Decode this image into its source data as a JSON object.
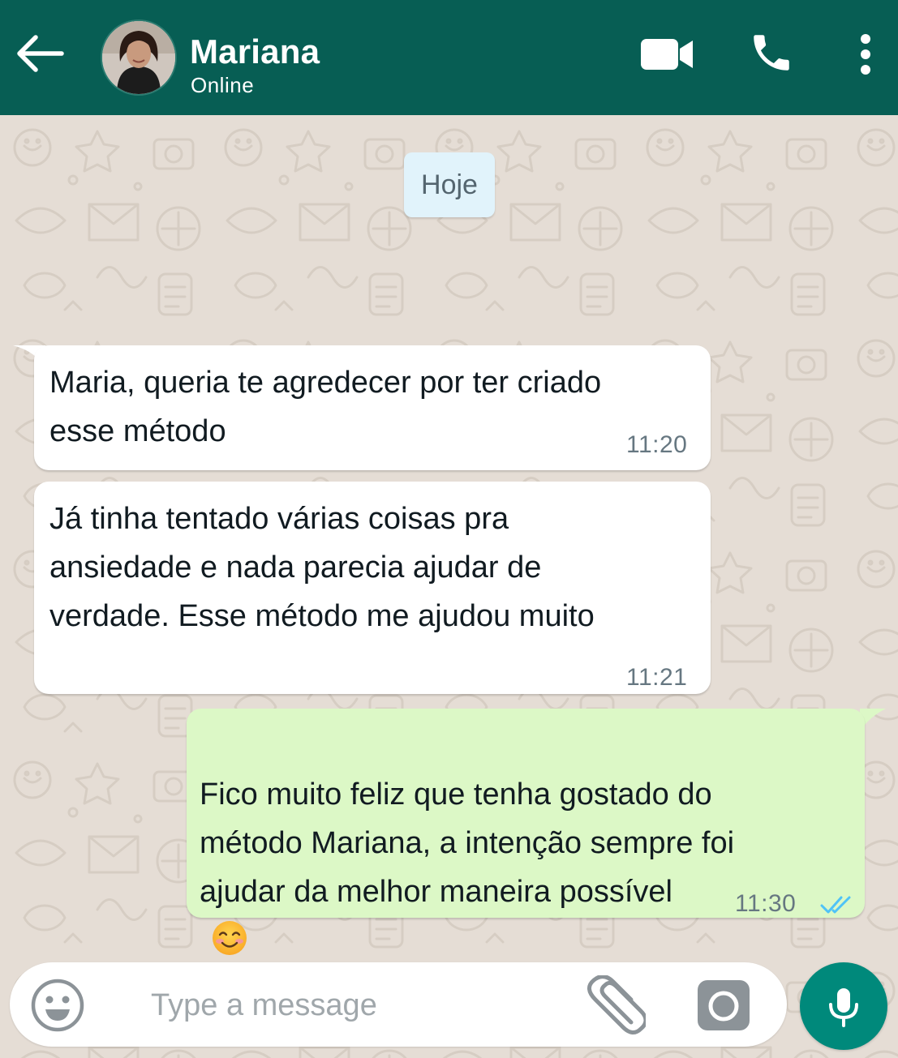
{
  "header": {
    "contact_name": "Mariana",
    "status": "Online",
    "background_color": "#075e54",
    "icons": [
      "back-arrow-icon",
      "video-call-icon",
      "phone-icon",
      "more-options-icon"
    ]
  },
  "chat": {
    "date_separator": "Hoje",
    "messages": [
      {
        "direction": "incoming",
        "text": "Maria, queria te agredecer por ter criado\nesse método",
        "time": "11:20"
      },
      {
        "direction": "incoming",
        "text": "Já tinha tentado várias coisas pra\nansiedade e nada parecia ajudar de\nverdade. Esse método me ajudou muito",
        "time": "11:21"
      },
      {
        "direction": "outgoing",
        "text": "Fico muito feliz que tenha gostado do\nmétodo Mariana, a intenção sempre foi\najudar da melhor maneira possível",
        "emoji": "smiling-face-emoji",
        "time": "11:30",
        "read_status": "read"
      }
    ]
  },
  "composer": {
    "placeholder": "Type a message",
    "icons": [
      "emoji-icon",
      "paperclip-icon",
      "camera-icon",
      "microphone-icon"
    ],
    "mic_color": "#00897b"
  },
  "colors": {
    "incoming_bubble": "#ffffff",
    "outgoing_bubble": "#dcf8c6",
    "read_ticks": "#4fc3f7",
    "wallpaper": "#e5ddd5"
  }
}
